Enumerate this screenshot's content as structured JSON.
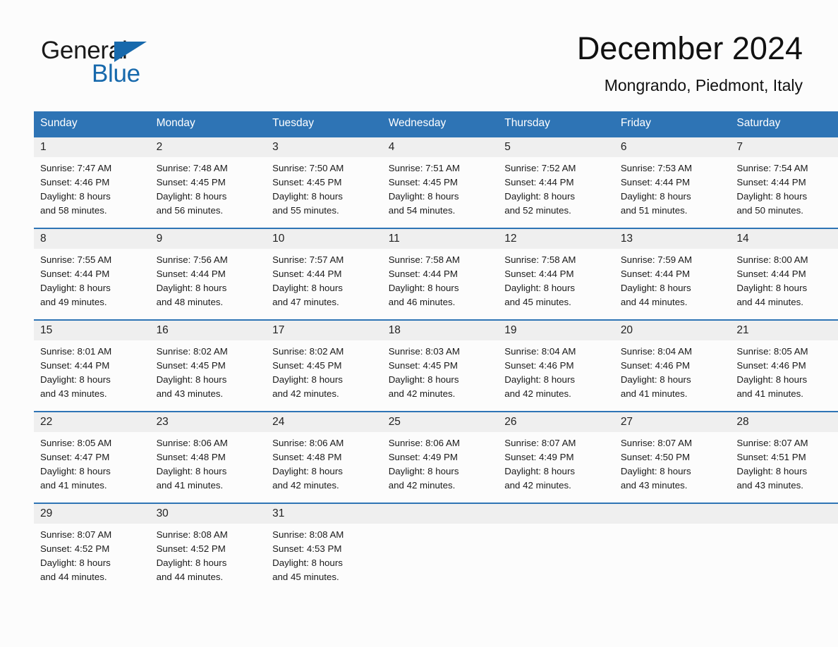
{
  "branding": {
    "logo_primary": "General",
    "logo_secondary": "Blue",
    "logo_triangle_color": "#1769ac",
    "accent_color": "#2e74b5",
    "band_color": "#efefef"
  },
  "header": {
    "month_title": "December 2024",
    "location": "Mongrando, Piedmont, Italy"
  },
  "weekday_headers": [
    "Sunday",
    "Monday",
    "Tuesday",
    "Wednesday",
    "Thursday",
    "Friday",
    "Saturday"
  ],
  "weeks": [
    [
      {
        "day": "1",
        "sunrise": "Sunrise: 7:47 AM",
        "sunset": "Sunset: 4:46 PM",
        "daylight_line1": "Daylight: 8 hours",
        "daylight_line2": "and 58 minutes."
      },
      {
        "day": "2",
        "sunrise": "Sunrise: 7:48 AM",
        "sunset": "Sunset: 4:45 PM",
        "daylight_line1": "Daylight: 8 hours",
        "daylight_line2": "and 56 minutes."
      },
      {
        "day": "3",
        "sunrise": "Sunrise: 7:50 AM",
        "sunset": "Sunset: 4:45 PM",
        "daylight_line1": "Daylight: 8 hours",
        "daylight_line2": "and 55 minutes."
      },
      {
        "day": "4",
        "sunrise": "Sunrise: 7:51 AM",
        "sunset": "Sunset: 4:45 PM",
        "daylight_line1": "Daylight: 8 hours",
        "daylight_line2": "and 54 minutes."
      },
      {
        "day": "5",
        "sunrise": "Sunrise: 7:52 AM",
        "sunset": "Sunset: 4:44 PM",
        "daylight_line1": "Daylight: 8 hours",
        "daylight_line2": "and 52 minutes."
      },
      {
        "day": "6",
        "sunrise": "Sunrise: 7:53 AM",
        "sunset": "Sunset: 4:44 PM",
        "daylight_line1": "Daylight: 8 hours",
        "daylight_line2": "and 51 minutes."
      },
      {
        "day": "7",
        "sunrise": "Sunrise: 7:54 AM",
        "sunset": "Sunset: 4:44 PM",
        "daylight_line1": "Daylight: 8 hours",
        "daylight_line2": "and 50 minutes."
      }
    ],
    [
      {
        "day": "8",
        "sunrise": "Sunrise: 7:55 AM",
        "sunset": "Sunset: 4:44 PM",
        "daylight_line1": "Daylight: 8 hours",
        "daylight_line2": "and 49 minutes."
      },
      {
        "day": "9",
        "sunrise": "Sunrise: 7:56 AM",
        "sunset": "Sunset: 4:44 PM",
        "daylight_line1": "Daylight: 8 hours",
        "daylight_line2": "and 48 minutes."
      },
      {
        "day": "10",
        "sunrise": "Sunrise: 7:57 AM",
        "sunset": "Sunset: 4:44 PM",
        "daylight_line1": "Daylight: 8 hours",
        "daylight_line2": "and 47 minutes."
      },
      {
        "day": "11",
        "sunrise": "Sunrise: 7:58 AM",
        "sunset": "Sunset: 4:44 PM",
        "daylight_line1": "Daylight: 8 hours",
        "daylight_line2": "and 46 minutes."
      },
      {
        "day": "12",
        "sunrise": "Sunrise: 7:58 AM",
        "sunset": "Sunset: 4:44 PM",
        "daylight_line1": "Daylight: 8 hours",
        "daylight_line2": "and 45 minutes."
      },
      {
        "day": "13",
        "sunrise": "Sunrise: 7:59 AM",
        "sunset": "Sunset: 4:44 PM",
        "daylight_line1": "Daylight: 8 hours",
        "daylight_line2": "and 44 minutes."
      },
      {
        "day": "14",
        "sunrise": "Sunrise: 8:00 AM",
        "sunset": "Sunset: 4:44 PM",
        "daylight_line1": "Daylight: 8 hours",
        "daylight_line2": "and 44 minutes."
      }
    ],
    [
      {
        "day": "15",
        "sunrise": "Sunrise: 8:01 AM",
        "sunset": "Sunset: 4:44 PM",
        "daylight_line1": "Daylight: 8 hours",
        "daylight_line2": "and 43 minutes."
      },
      {
        "day": "16",
        "sunrise": "Sunrise: 8:02 AM",
        "sunset": "Sunset: 4:45 PM",
        "daylight_line1": "Daylight: 8 hours",
        "daylight_line2": "and 43 minutes."
      },
      {
        "day": "17",
        "sunrise": "Sunrise: 8:02 AM",
        "sunset": "Sunset: 4:45 PM",
        "daylight_line1": "Daylight: 8 hours",
        "daylight_line2": "and 42 minutes."
      },
      {
        "day": "18",
        "sunrise": "Sunrise: 8:03 AM",
        "sunset": "Sunset: 4:45 PM",
        "daylight_line1": "Daylight: 8 hours",
        "daylight_line2": "and 42 minutes."
      },
      {
        "day": "19",
        "sunrise": "Sunrise: 8:04 AM",
        "sunset": "Sunset: 4:46 PM",
        "daylight_line1": "Daylight: 8 hours",
        "daylight_line2": "and 42 minutes."
      },
      {
        "day": "20",
        "sunrise": "Sunrise: 8:04 AM",
        "sunset": "Sunset: 4:46 PM",
        "daylight_line1": "Daylight: 8 hours",
        "daylight_line2": "and 41 minutes."
      },
      {
        "day": "21",
        "sunrise": "Sunrise: 8:05 AM",
        "sunset": "Sunset: 4:46 PM",
        "daylight_line1": "Daylight: 8 hours",
        "daylight_line2": "and 41 minutes."
      }
    ],
    [
      {
        "day": "22",
        "sunrise": "Sunrise: 8:05 AM",
        "sunset": "Sunset: 4:47 PM",
        "daylight_line1": "Daylight: 8 hours",
        "daylight_line2": "and 41 minutes."
      },
      {
        "day": "23",
        "sunrise": "Sunrise: 8:06 AM",
        "sunset": "Sunset: 4:48 PM",
        "daylight_line1": "Daylight: 8 hours",
        "daylight_line2": "and 41 minutes."
      },
      {
        "day": "24",
        "sunrise": "Sunrise: 8:06 AM",
        "sunset": "Sunset: 4:48 PM",
        "daylight_line1": "Daylight: 8 hours",
        "daylight_line2": "and 42 minutes."
      },
      {
        "day": "25",
        "sunrise": "Sunrise: 8:06 AM",
        "sunset": "Sunset: 4:49 PM",
        "daylight_line1": "Daylight: 8 hours",
        "daylight_line2": "and 42 minutes."
      },
      {
        "day": "26",
        "sunrise": "Sunrise: 8:07 AM",
        "sunset": "Sunset: 4:49 PM",
        "daylight_line1": "Daylight: 8 hours",
        "daylight_line2": "and 42 minutes."
      },
      {
        "day": "27",
        "sunrise": "Sunrise: 8:07 AM",
        "sunset": "Sunset: 4:50 PM",
        "daylight_line1": "Daylight: 8 hours",
        "daylight_line2": "and 43 minutes."
      },
      {
        "day": "28",
        "sunrise": "Sunrise: 8:07 AM",
        "sunset": "Sunset: 4:51 PM",
        "daylight_line1": "Daylight: 8 hours",
        "daylight_line2": "and 43 minutes."
      }
    ],
    [
      {
        "day": "29",
        "sunrise": "Sunrise: 8:07 AM",
        "sunset": "Sunset: 4:52 PM",
        "daylight_line1": "Daylight: 8 hours",
        "daylight_line2": "and 44 minutes."
      },
      {
        "day": "30",
        "sunrise": "Sunrise: 8:08 AM",
        "sunset": "Sunset: 4:52 PM",
        "daylight_line1": "Daylight: 8 hours",
        "daylight_line2": "and 44 minutes."
      },
      {
        "day": "31",
        "sunrise": "Sunrise: 8:08 AM",
        "sunset": "Sunset: 4:53 PM",
        "daylight_line1": "Daylight: 8 hours",
        "daylight_line2": "and 45 minutes."
      },
      {
        "day": "",
        "sunrise": "",
        "sunset": "",
        "daylight_line1": "",
        "daylight_line2": ""
      },
      {
        "day": "",
        "sunrise": "",
        "sunset": "",
        "daylight_line1": "",
        "daylight_line2": ""
      },
      {
        "day": "",
        "sunrise": "",
        "sunset": "",
        "daylight_line1": "",
        "daylight_line2": ""
      },
      {
        "day": "",
        "sunrise": "",
        "sunset": "",
        "daylight_line1": "",
        "daylight_line2": ""
      }
    ]
  ]
}
